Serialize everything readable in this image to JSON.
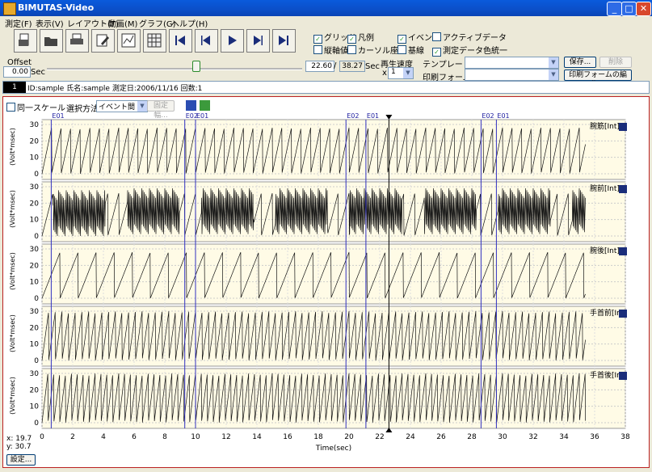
{
  "window": {
    "title": "BIMUTAS-Video"
  },
  "menu": [
    "測定(F)",
    "表示(V)",
    "レイアウト(T)",
    "動画(M)",
    "グラフ(G)",
    "ヘルプ(H)"
  ],
  "toolbar_icons": [
    "open-file-icon",
    "folder-icon",
    "print-icon",
    "edit-icon",
    "layout-icon",
    "grid-icon",
    "skip-start-icon",
    "step-back-icon",
    "play-icon",
    "step-forward-icon",
    "skip-end-icon"
  ],
  "options": {
    "grid": {
      "label": "グリッド",
      "checked": true
    },
    "legend": {
      "label": "凡例",
      "checked": true
    },
    "event": {
      "label": "イベント",
      "checked": true
    },
    "active_data": {
      "label": "アクティブデータ",
      "checked": false
    },
    "vertical_value": {
      "label": "縦軸値",
      "checked": false
    },
    "cursor_coord": {
      "label": "カーソル座標",
      "checked": false
    },
    "baseline": {
      "label": "基線",
      "checked": false
    },
    "color_unify": {
      "label": "測定データ色統一",
      "checked": true
    }
  },
  "template_label": "テンプレート:",
  "print_form_label": "印刷フォーム:",
  "save_btn": "保存...",
  "delete_btn": "削除",
  "print_edit_btn": "印刷フォームの編集...",
  "offset_label": "Offset",
  "offset_value": "0.00",
  "sec1": "Sec",
  "time_current": "22.60",
  "time_total": "38.27",
  "slash": "/",
  "sec2": "Sec",
  "speed_label": "再生速度",
  "speed_value": "1",
  "speed_x": "x",
  "info_index": "1",
  "info_text": "ID:sample 氏名:sample 測定日:2006/11/16 回数:1",
  "same_scale": "同一スケール",
  "select_method_label": "選択方法:",
  "select_method_value": "イベント間",
  "fixed_width_btn": "固定幅...",
  "status": {
    "x": "19.7",
    "y": "30.7",
    "settings": "設定..."
  },
  "chart_data": {
    "type": "line",
    "xlabel": "Time(sec)",
    "xlim": [
      0,
      38
    ],
    "xticks": [
      0,
      2,
      4,
      6,
      8,
      10,
      12,
      14,
      16,
      18,
      20,
      22,
      24,
      26,
      28,
      30,
      32,
      34,
      36,
      38
    ],
    "cursor_x": 22.6,
    "events": [
      {
        "label": "E01",
        "x": 0.6
      },
      {
        "label": "E02",
        "x": 9.3
      },
      {
        "label": "E01",
        "x": 10.0
      },
      {
        "label": "E02",
        "x": 19.8
      },
      {
        "label": "E01",
        "x": 21.1
      },
      {
        "label": "E02",
        "x": 28.6
      },
      {
        "label": "E01",
        "x": 29.6
      }
    ],
    "series": [
      {
        "name": "腕筋[Int]",
        "ylabel": "(Volt*msec)",
        "ylim": [
          0,
          30
        ],
        "yticks": [
          0,
          10,
          20,
          30
        ],
        "pattern": "ramp_fast"
      },
      {
        "name": "腕前[Int]",
        "ylabel": "(Volt*msec)",
        "ylim": [
          0,
          30
        ],
        "yticks": [
          0,
          10,
          20,
          30
        ],
        "pattern": "dense_bursts"
      },
      {
        "name": "腕後[Int]",
        "ylabel": "(Volt*msec)",
        "ylim": [
          0,
          30
        ],
        "yticks": [
          0,
          10,
          20,
          30
        ],
        "pattern": "ramp_slow"
      },
      {
        "name": "手首前[Int]",
        "ylabel": "(Volt*msec)",
        "ylim": [
          0,
          30
        ],
        "yticks": [
          0,
          10,
          20,
          30
        ],
        "pattern": "ramp_medium"
      },
      {
        "name": "手首後[Int]",
        "ylabel": "(Volt*msec)",
        "ylim": [
          0,
          30
        ],
        "yticks": [
          0,
          10,
          20,
          30
        ],
        "pattern": "ramp_medium2"
      }
    ]
  }
}
